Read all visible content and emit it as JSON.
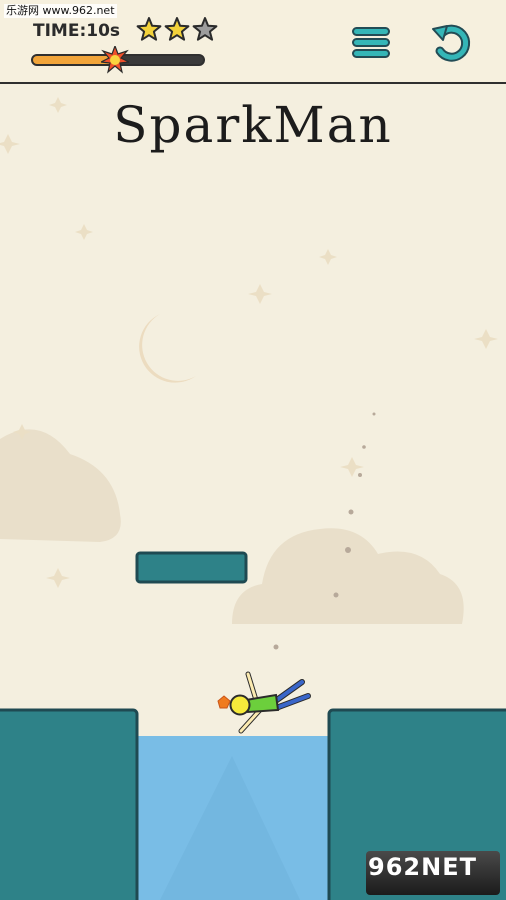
{
  "watermark": {
    "text": "乐游网 www.962.net"
  },
  "hud": {
    "time_label": "TIME:10s",
    "stars": {
      "earned": 2,
      "total": 3
    },
    "progress": {
      "fraction": 0.48
    },
    "menu_icon": "hamburger-menu-icon",
    "restart_icon": "restart-arrow-icon"
  },
  "level": {
    "title": "SparkMan"
  },
  "badge": {
    "prefix": "962",
    "suffix": "NET"
  },
  "colors": {
    "background": "#f4efdf",
    "teal": "#2e8288",
    "water": "#79bde6",
    "star_gold": "#f3d23b",
    "star_gray": "#9d9d9d",
    "progress_orange": "#f1a439"
  }
}
